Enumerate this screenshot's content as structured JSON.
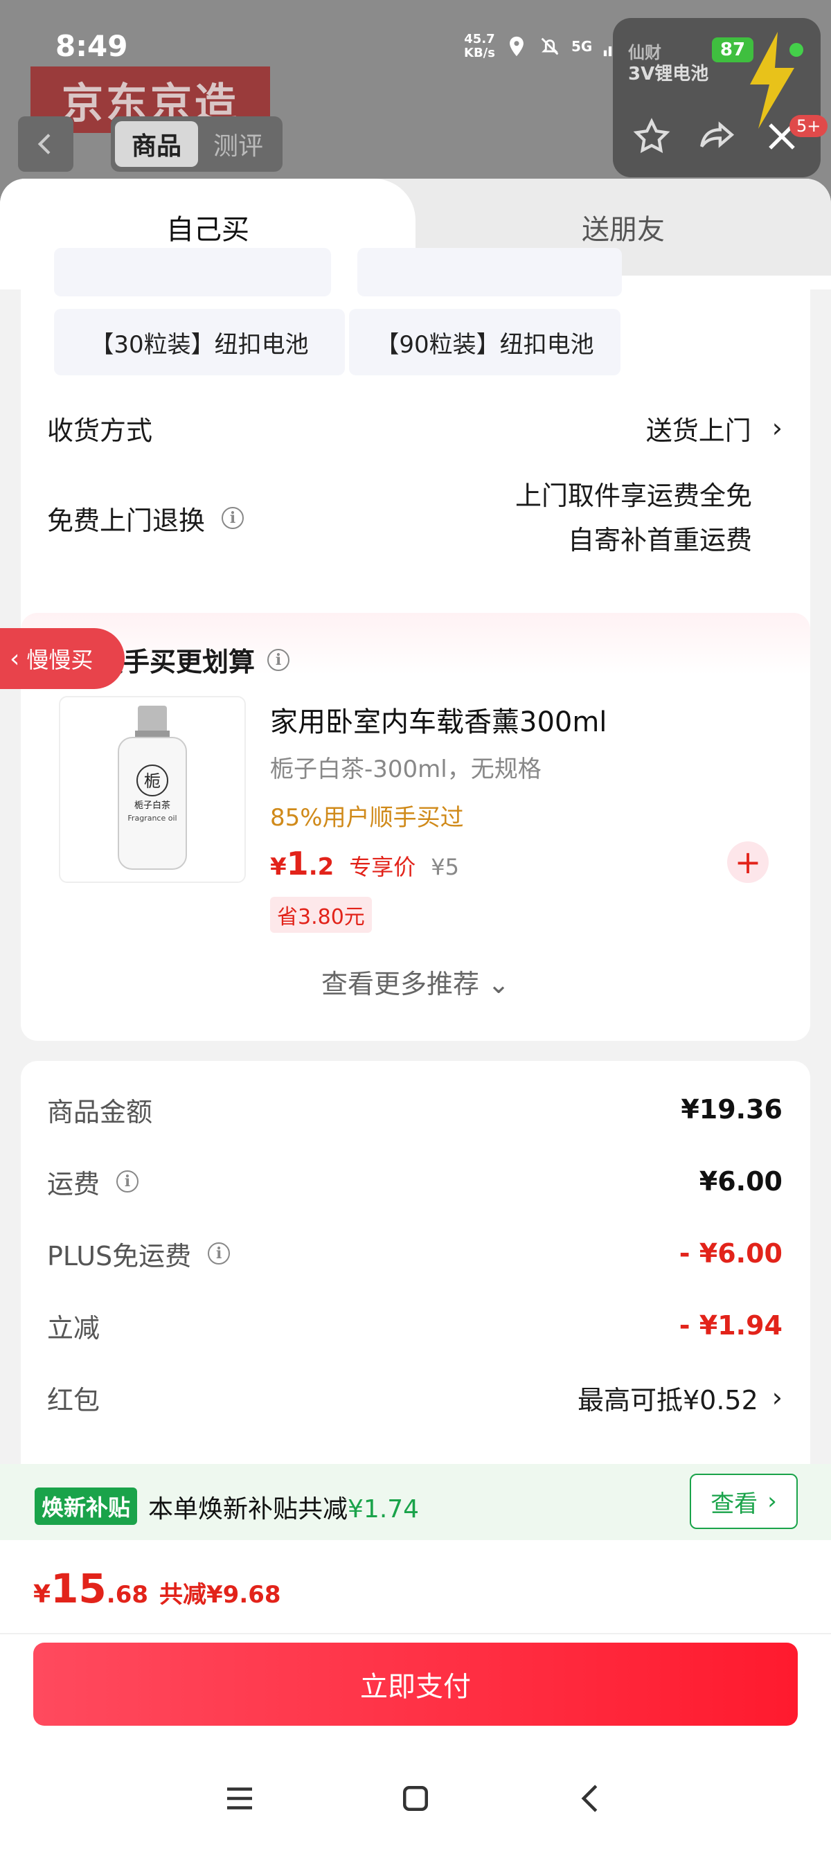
{
  "status_bar": {
    "time": "8:49",
    "net_speed_value": "45.7",
    "net_speed_unit": "KB/s",
    "network": "5G",
    "battery": "87"
  },
  "background_page": {
    "banner_text": "京东京造",
    "tab_product": "商品",
    "tab_review": "测评",
    "mini_card_text": "3V锂电池",
    "mini_card_brand": "仙财",
    "badge": "5+"
  },
  "sheet": {
    "tabs": [
      "自己买",
      "送朋友"
    ],
    "options": [
      "【30粒装】纽扣电池",
      "【90粒装】纽扣电池"
    ],
    "delivery": {
      "label": "收货方式",
      "value": "送货上门"
    },
    "return": {
      "label": "免费上门退换",
      "line1": "上门取件享运费全免",
      "line2": "自寄补首重运费"
    }
  },
  "addon": {
    "side_tag": "慢慢买",
    "heading": "顺手买更划算",
    "product": {
      "title": "家用卧室内车载香薰300ml",
      "spec": "栀子白茶-300ml，无规格",
      "bought": "85%用户顺手买过",
      "price_symbol": "¥",
      "price_int": "1",
      "price_dec": ".2",
      "exclusive": "专享价",
      "old_price": "¥5",
      "save": "省3.80元",
      "img_char": "栀",
      "img_label": "栀子白茶",
      "img_sub": "Fragrance oil"
    },
    "more": "查看更多推荐 ⌄"
  },
  "summary": {
    "rows": [
      {
        "label": "商品金额",
        "value": "¥19.36"
      },
      {
        "label": "运费",
        "value": "¥6.00"
      },
      {
        "label": "PLUS免运费",
        "value": "- ¥6.00"
      },
      {
        "label": "立减",
        "value": "- ¥1.94"
      },
      {
        "label": "红包",
        "value": "最高可抵¥0.52"
      }
    ]
  },
  "subsidy": {
    "badge": "焕新补贴",
    "text_prefix": "本单焕新补贴共减",
    "amount": "¥1.74",
    "button": "查看"
  },
  "checkout": {
    "cur": "¥",
    "int": "15",
    "dec": ".68",
    "reduce": "共减¥9.68",
    "pay_button": "立即支付"
  },
  "colors": {
    "accent_red": "#e2231a",
    "subsidy_green": "#1aa34a",
    "bought_orange": "#d08a1a"
  }
}
